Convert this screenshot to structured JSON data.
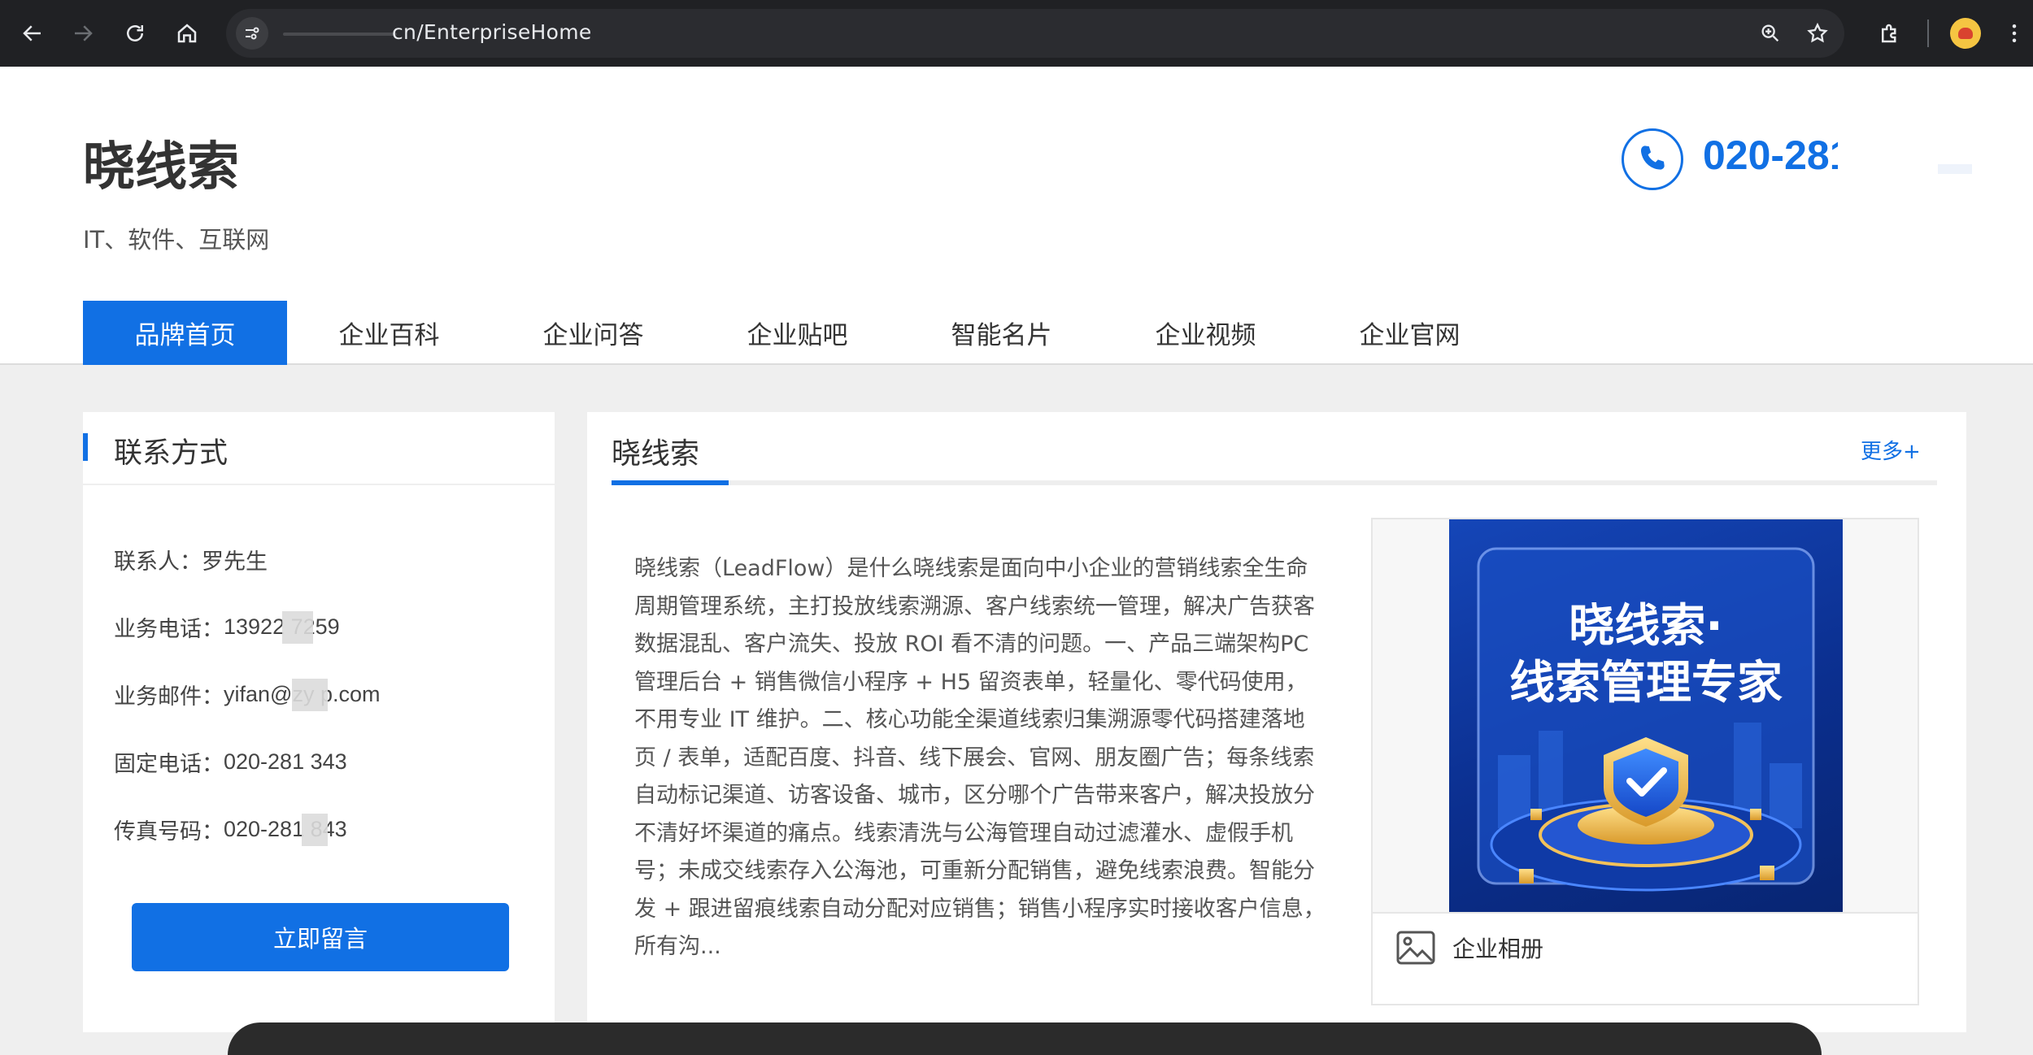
{
  "browser": {
    "url": "cn/EnterpriseHome",
    "icons": [
      "back-icon",
      "forward-icon",
      "reload-icon",
      "home-icon",
      "site-info-icon",
      "zoom-icon",
      "star-icon",
      "extensions-icon",
      "profile-icon"
    ]
  },
  "header": {
    "brand": "晓线索",
    "industry": "IT、软件、互联网",
    "phone": "020-281"
  },
  "tabs": [
    {
      "label": "品牌首页",
      "active": true
    },
    {
      "label": "企业百科",
      "active": false
    },
    {
      "label": "企业问答",
      "active": false
    },
    {
      "label": "企业贴吧",
      "active": false
    },
    {
      "label": "智能名片",
      "active": false
    },
    {
      "label": "企业视频",
      "active": false
    },
    {
      "label": "企业官网",
      "active": false
    }
  ],
  "contact": {
    "title": "联系方式",
    "rows": [
      {
        "label": "联系人：",
        "value": "罗先生"
      },
      {
        "label": "业务电话：",
        "value": "13922 7259"
      },
      {
        "label": "业务邮件：",
        "value": "yifan@zy p.com"
      },
      {
        "label": "固定电话：",
        "value": "020-281 343"
      },
      {
        "label": "传真号码：",
        "value": "020-281 843"
      }
    ],
    "button": "立即留言"
  },
  "main": {
    "title": "晓线索",
    "more": "更多+",
    "description": "晓线索（LeadFlow）是什么晓线索是面向中小企业的营销线索全生命周期管理系统，主打投放线索溯源、客户线索统一管理，解决广告获客数据混乱、客户流失、投放 ROI 看不清的问题。一、产品三端架构PC 管理后台 + 销售微信小程序 + H5 留资表单，轻量化、零代码使用，不用专业 IT 维护。二、核心功能全渠道线索归集溯源零代码搭建落地页 / 表单，适配百度、抖音、线下展会、官网、朋友圈广告；每条线索自动标记渠道、访客设备、城市，区分哪个广告带来客户，解决投放分不清好坏渠道的痛点。线索清洗与公海管理自动过滤灌水、虚假手机号；未成交线索存入公海池，可重新分配销售，避免线索浪费。智能分发 + 跟进留痕线索自动分配对应销售；销售小程序实时接收客户信息，所有沟...",
    "album_label": "企业相册",
    "poster_line1": "晓线索·",
    "poster_line2": "线索管理专家"
  },
  "colors": {
    "accent": "#1170e4",
    "chrome": "#202124",
    "page_bg": "#efefef"
  }
}
